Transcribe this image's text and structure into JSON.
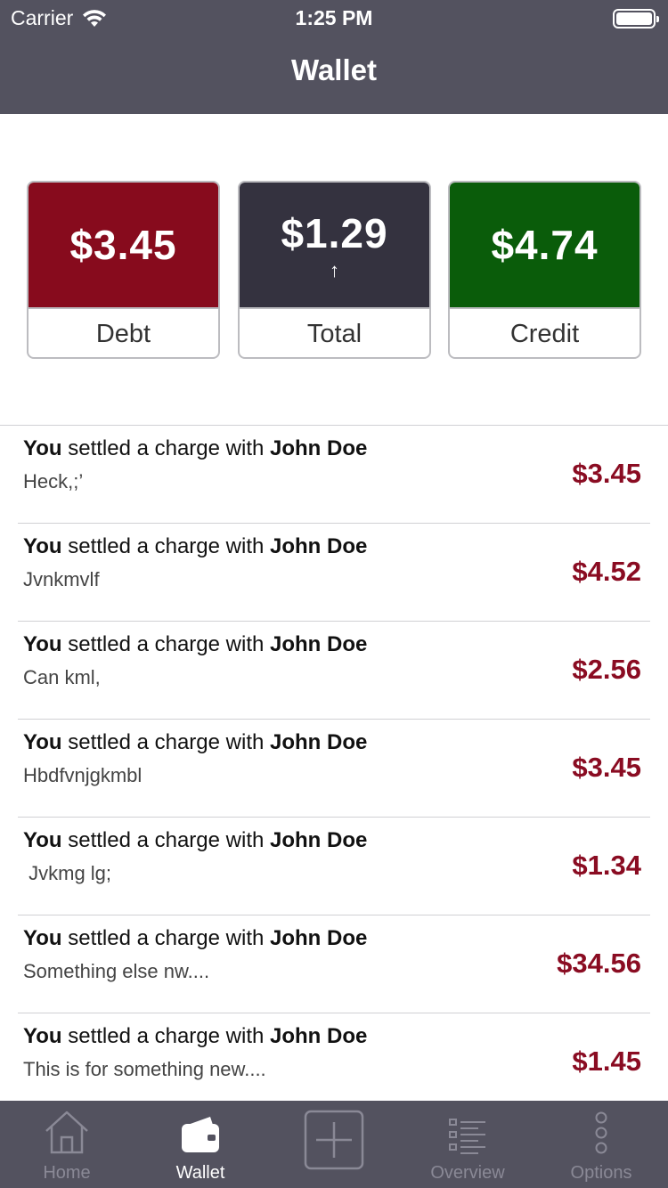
{
  "status": {
    "carrier": "Carrier",
    "time": "1:25 PM"
  },
  "nav": {
    "title": "Wallet"
  },
  "summary": {
    "debt": {
      "amount": "$3.45",
      "label": "Debt",
      "color": "#870b1d"
    },
    "total": {
      "amount": "$1.29",
      "arrow": "↑",
      "label": "Total",
      "color": "#34323f"
    },
    "credit": {
      "amount": "$4.74",
      "label": "Credit",
      "color": "#0a5c0a"
    }
  },
  "transactions": [
    {
      "actor": "You",
      "action": " settled a charge with ",
      "party": "John Doe",
      "note": "Heck,;’",
      "amount": "$3.45"
    },
    {
      "actor": "You",
      "action": " settled a charge with ",
      "party": "John Doe",
      "note": "Jvnkmvlf",
      "amount": "$4.52"
    },
    {
      "actor": "You",
      "action": " settled a charge with ",
      "party": "John Doe",
      "note": "Can kml,",
      "amount": "$2.56"
    },
    {
      "actor": "You",
      "action": " settled a charge with ",
      "party": "John Doe",
      "note": "Hbdfvnjgkmbl",
      "amount": "$3.45"
    },
    {
      "actor": "You",
      "action": " settled a charge with ",
      "party": "John Doe",
      "note": " Jvkmg lg;",
      "amount": "$1.34"
    },
    {
      "actor": "You",
      "action": " settled a charge with ",
      "party": "John Doe",
      "note": "Something else nw....",
      "amount": "$34.56"
    },
    {
      "actor": "You",
      "action": " settled a charge with ",
      "party": "John Doe",
      "note": "This is for something new....",
      "amount": "$1.45"
    }
  ],
  "tabs": [
    {
      "label": "Home",
      "icon": "home-icon",
      "active": false
    },
    {
      "label": "Wallet",
      "icon": "wallet-icon",
      "active": true
    },
    {
      "label": "",
      "icon": "add-icon",
      "active": false
    },
    {
      "label": "Overview",
      "icon": "list-icon",
      "active": false
    },
    {
      "label": "Options",
      "icon": "more-icon",
      "active": false
    }
  ],
  "colors": {
    "bar": "#53525f",
    "amount_negative": "#8a0c22",
    "tab_inactive": "#8a8996",
    "tab_active": "#ffffff"
  }
}
